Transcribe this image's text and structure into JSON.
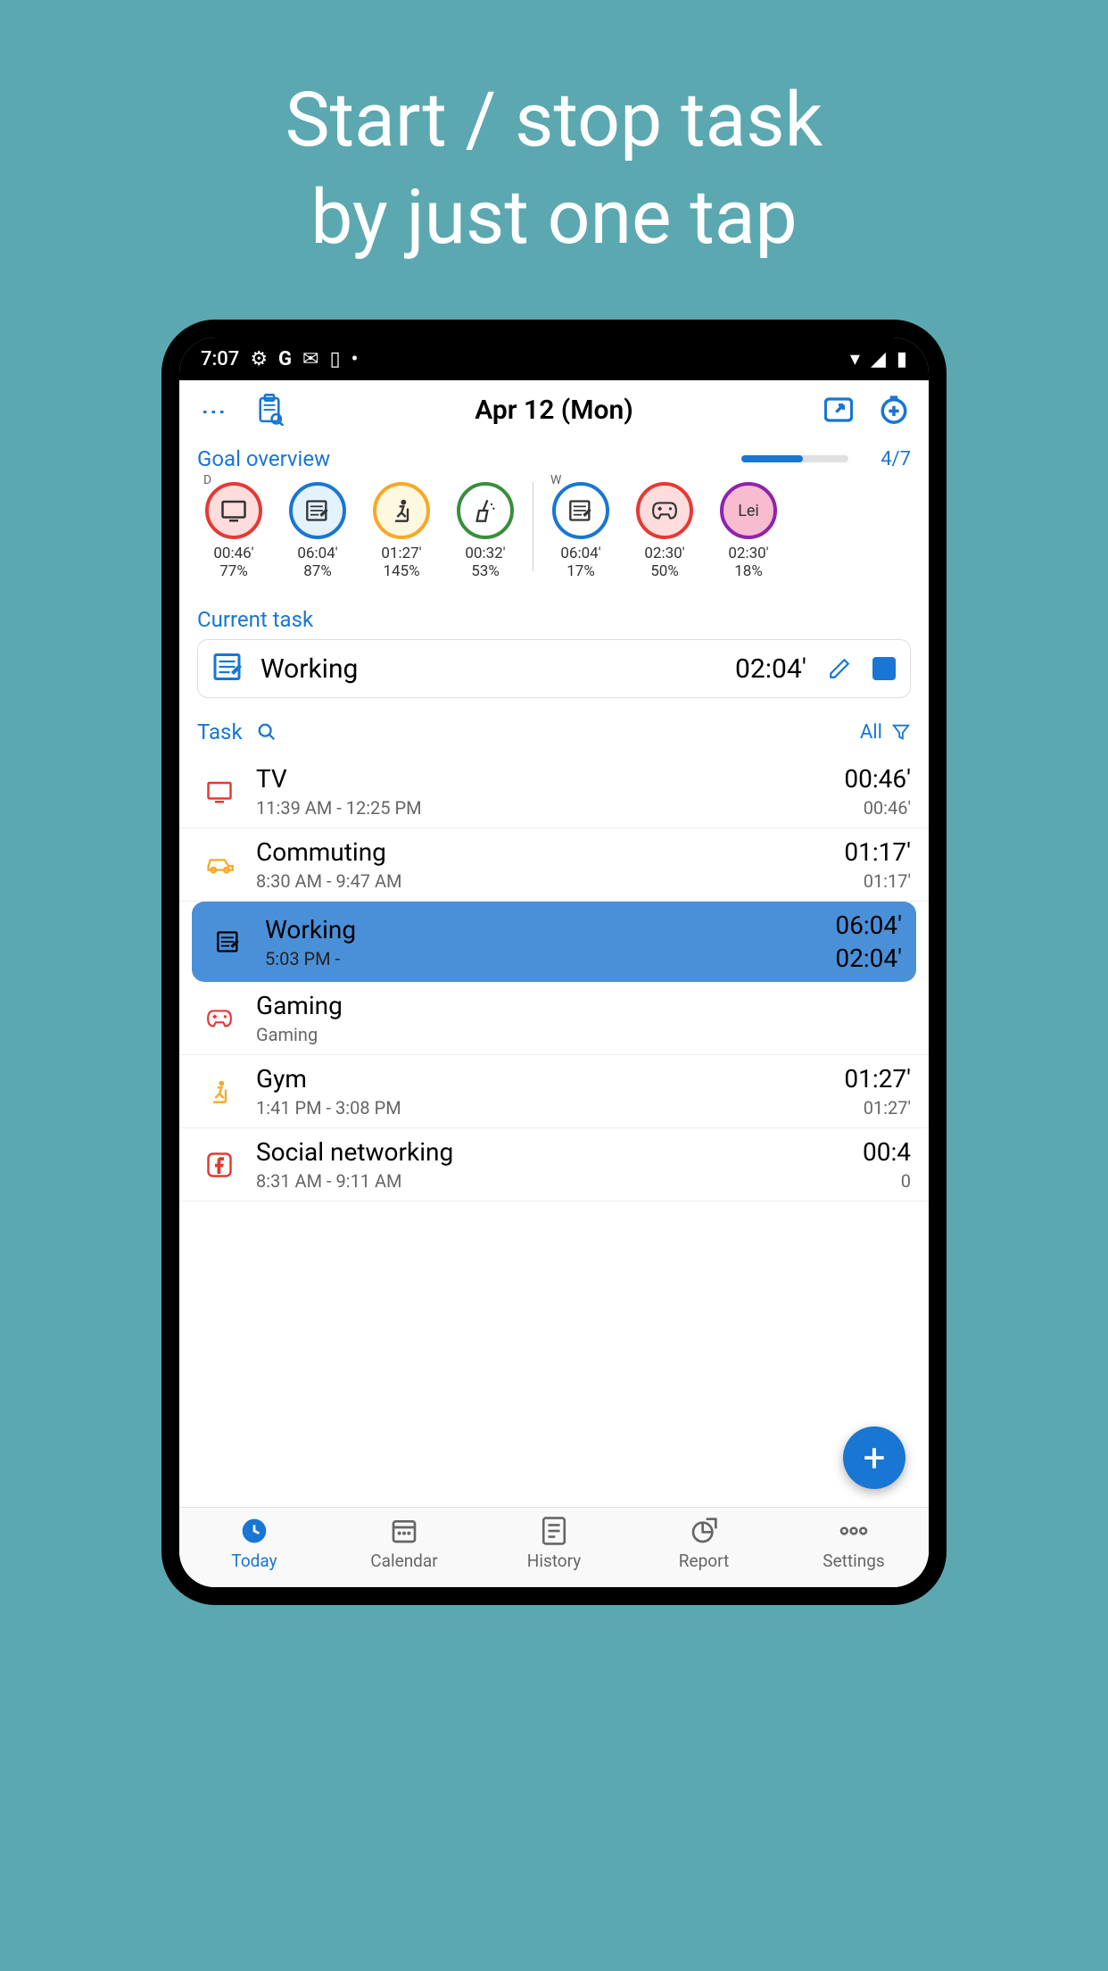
{
  "promo": {
    "line1": "Start / stop task",
    "line2": "by just one tap"
  },
  "statusBar": {
    "time": "7:07"
  },
  "header": {
    "title": "Apr 12 (Mon)"
  },
  "goalOverview": {
    "title": "Goal overview",
    "progress": 57,
    "fraction": "4/7",
    "items": [
      {
        "period": "D",
        "icon": "tv",
        "color": "#e53935",
        "bg": "#ffdddd",
        "time": "00:46'",
        "pct": "77%"
      },
      {
        "period": "",
        "icon": "note",
        "color": "#1976d2",
        "bg": "#e3f2fd",
        "time": "06:04'",
        "pct": "87%"
      },
      {
        "period": "",
        "icon": "gym",
        "color": "#f9a825",
        "bg": "#fff8e1",
        "time": "01:27'",
        "pct": "145%"
      },
      {
        "period": "",
        "icon": "clean",
        "color": "#388e3c",
        "bg": "#ffffff",
        "time": "00:32'",
        "pct": "53%"
      },
      {
        "period": "W",
        "icon": "note",
        "color": "#1976d2",
        "bg": "#ffffff",
        "time": "06:04'",
        "pct": "17%"
      },
      {
        "period": "",
        "icon": "game",
        "color": "#e53935",
        "bg": "#ffdddd",
        "time": "02:30'",
        "pct": "50%"
      },
      {
        "period": "",
        "icon": "lei",
        "color": "#8e24aa",
        "bg": "#f8bbd0",
        "time": "02:30'",
        "pct": "18%",
        "text": "Lei"
      }
    ]
  },
  "currentTask": {
    "title": "Current task",
    "name": "Working",
    "time": "02:04'"
  },
  "taskSection": {
    "label": "Task",
    "allLabel": "All"
  },
  "tasks": [
    {
      "icon": "tv",
      "color": "#e53935",
      "name": "TV",
      "sub": "11:39 AM - 12:25 PM",
      "t1": "00:46'",
      "t2": "00:46'",
      "active": false
    },
    {
      "icon": "car",
      "color": "#f9a825",
      "name": "Commuting",
      "sub": "8:30 AM - 9:47 AM",
      "t1": "01:17'",
      "t2": "01:17'",
      "active": false
    },
    {
      "icon": "note",
      "color": "#000",
      "name": "Working",
      "sub": "5:03 PM -",
      "t1": "06:04'",
      "t2": "02:04'",
      "active": true
    },
    {
      "icon": "game",
      "color": "#e53935",
      "name": "Gaming",
      "sub": "Gaming",
      "t1": "",
      "t2": "",
      "active": false
    },
    {
      "icon": "gym",
      "color": "#f9a825",
      "name": "Gym",
      "sub": "1:41 PM - 3:08 PM",
      "t1": "01:27'",
      "t2": "01:27'",
      "active": false
    },
    {
      "icon": "fb",
      "color": "#e53935",
      "name": "Social networking",
      "sub": "8:31 AM - 9:11 AM",
      "t1": "00:4",
      "t2": "0",
      "active": false
    }
  ],
  "bottomNav": {
    "items": [
      {
        "icon": "clock",
        "label": "Today",
        "active": true
      },
      {
        "icon": "calendar",
        "label": "Calendar",
        "active": false
      },
      {
        "icon": "history",
        "label": "History",
        "active": false
      },
      {
        "icon": "report",
        "label": "Report",
        "active": false
      },
      {
        "icon": "settings",
        "label": "Settings",
        "active": false
      }
    ]
  }
}
